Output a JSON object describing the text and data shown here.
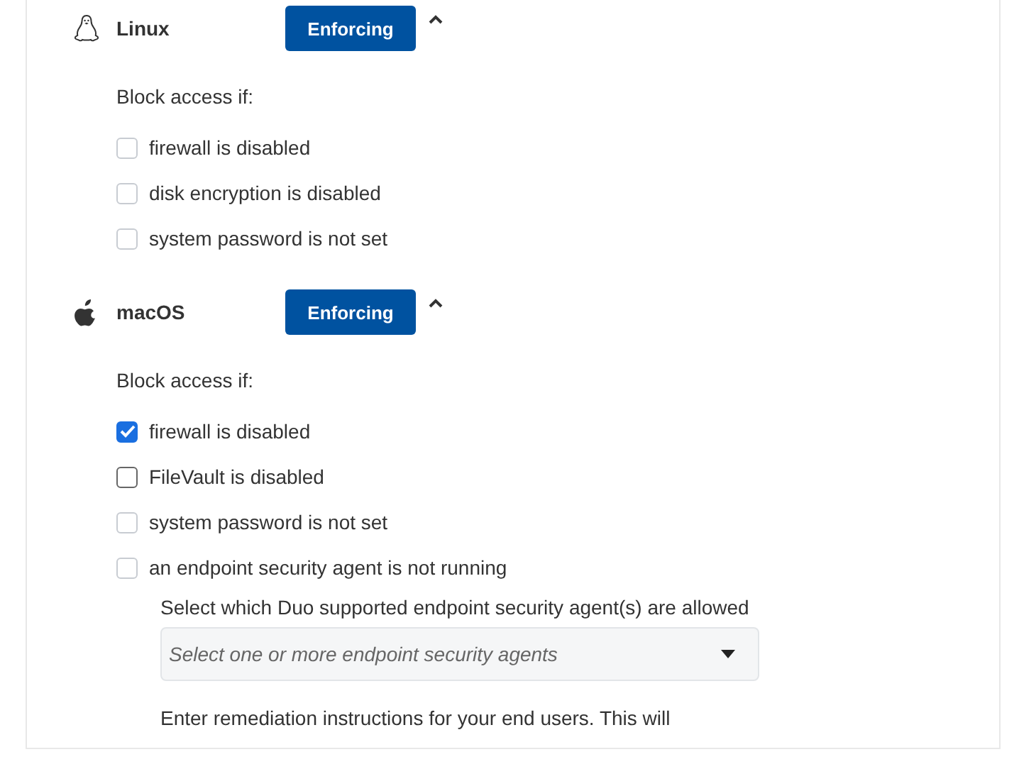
{
  "platforms": [
    {
      "name": "Linux",
      "kind": "penguin",
      "status": "Enforcing",
      "expanded": true,
      "block_label": "Block access if:",
      "options": [
        {
          "label": "firewall is disabled",
          "checked": false,
          "disabled": true
        },
        {
          "label": "disk encryption is disabled",
          "checked": false,
          "disabled": true
        },
        {
          "label": "system password is not set",
          "checked": false,
          "disabled": true
        }
      ]
    },
    {
      "name": "macOS",
      "kind": "apple",
      "status": "Enforcing",
      "expanded": true,
      "block_label": "Block access if:",
      "options": [
        {
          "label": "firewall is disabled",
          "checked": true,
          "disabled": false
        },
        {
          "label": "FileVault is disabled",
          "checked": false,
          "disabled": false
        },
        {
          "label": "system password is not set",
          "checked": false,
          "disabled": true
        },
        {
          "label": "an endpoint security agent is not running",
          "checked": false,
          "disabled": true
        }
      ],
      "agent_select": {
        "label": "Select which Duo supported endpoint security agent(s) are allowed",
        "placeholder": "Select one or more endpoint security agents"
      },
      "remediation_text": "Enter remediation instructions for your end users. This will"
    }
  ]
}
